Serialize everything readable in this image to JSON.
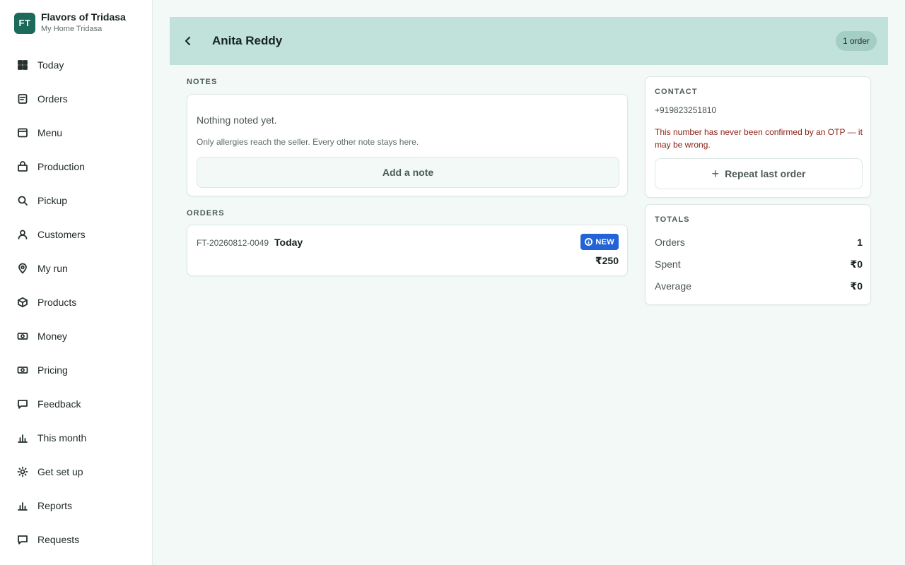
{
  "brand": {
    "initials": "FT",
    "name": "Flavors of Tridasa",
    "subtitle": "My Home Tridasa"
  },
  "nav": [
    {
      "label": "Today",
      "icon": "dashboard-grid-icon"
    },
    {
      "label": "Orders",
      "icon": "receipt-icon"
    },
    {
      "label": "Menu",
      "icon": "menu-card-icon"
    },
    {
      "label": "Production",
      "icon": "bag-icon"
    },
    {
      "label": "Pickup",
      "icon": "search-icon"
    },
    {
      "label": "Customers",
      "icon": "user-icon"
    },
    {
      "label": "My run",
      "icon": "map-pin-icon"
    },
    {
      "label": "Products",
      "icon": "box-icon"
    },
    {
      "label": "Money",
      "icon": "banknote-icon"
    },
    {
      "label": "Pricing",
      "icon": "banknote-icon"
    },
    {
      "label": "Feedback",
      "icon": "message-icon"
    },
    {
      "label": "This month",
      "icon": "bar-chart-icon"
    },
    {
      "label": "Get set up",
      "icon": "settings-sun-icon"
    },
    {
      "label": "Reports",
      "icon": "bar-chart-icon"
    },
    {
      "label": "Requests",
      "icon": "message-icon"
    }
  ],
  "header": {
    "title": "Anita Reddy",
    "order_count": "1 order"
  },
  "notes": {
    "label": "NOTES",
    "empty": "Nothing noted yet.",
    "hint": "Only allergies reach the seller. Every other note stays here.",
    "add_label": "Add a note"
  },
  "orders": {
    "label": "ORDERS",
    "items": [
      {
        "id": "FT-20260812-0049",
        "day": "Today",
        "status": "NEW",
        "amount": "₹250"
      }
    ]
  },
  "contact": {
    "label": "CONTACT",
    "phone": "+919823251810",
    "warning": "This number has never been confirmed by an OTP — it may be wrong.",
    "repeat_label": "Repeat last order"
  },
  "totals": {
    "label": "TOTALS",
    "rows": [
      {
        "key": "Orders",
        "value": "1"
      },
      {
        "key": "Spent",
        "value": "₹0"
      },
      {
        "key": "Average",
        "value": "₹0"
      }
    ]
  },
  "colors": {
    "brand": "#1c6a5b",
    "header_bg": "#c0e2da",
    "badge_new": "#2463d6",
    "warning_text": "#8a1f14",
    "page_bg": "#f2f9f7"
  }
}
